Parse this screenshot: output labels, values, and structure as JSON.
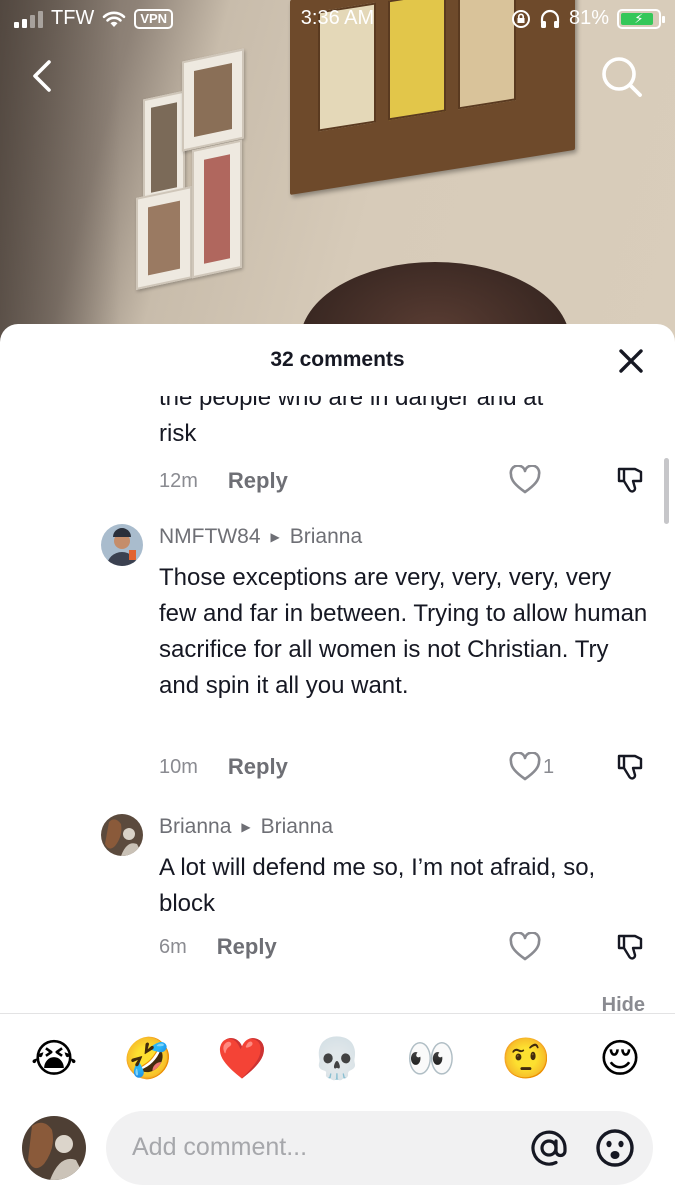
{
  "status_bar": {
    "carrier": "TFW",
    "vpn_label": "VPN",
    "time": "3:36 AM",
    "battery": "81%",
    "battery_color": "#35c759"
  },
  "nav": {
    "back_icon": "chevron-left-icon",
    "search_icon": "search-icon"
  },
  "sheet": {
    "title": "32 comments",
    "close_icon": "close-icon"
  },
  "comments": [
    {
      "text_partial": "the people who are in danger and at",
      "text_end": "risk",
      "time": "12m",
      "reply_label": "Reply",
      "likes": ""
    },
    {
      "author": "NMFTW84",
      "reply_to": "Brianna",
      "text": "Those exceptions are very, very, very, very few and far in between. Trying to allow human sacrifice for all women is not Christian. Try and spin it all you want.",
      "time": "10m",
      "reply_label": "Reply",
      "likes": "1"
    },
    {
      "author": "Brianna",
      "reply_to": "Brianna",
      "text": "A lot will defend me so, I’m not afraid, so, block",
      "time": "6m",
      "reply_label": "Reply",
      "likes": ""
    }
  ],
  "hide_label": "Hide",
  "emoji_bar": [
    "😭",
    "🤣",
    "❤️",
    "💀",
    "👀",
    "🤨",
    "😌"
  ],
  "composer": {
    "placeholder": "Add comment...",
    "mention_icon": "at-sign-icon",
    "emoji_icon": "emoji-picker-icon"
  }
}
